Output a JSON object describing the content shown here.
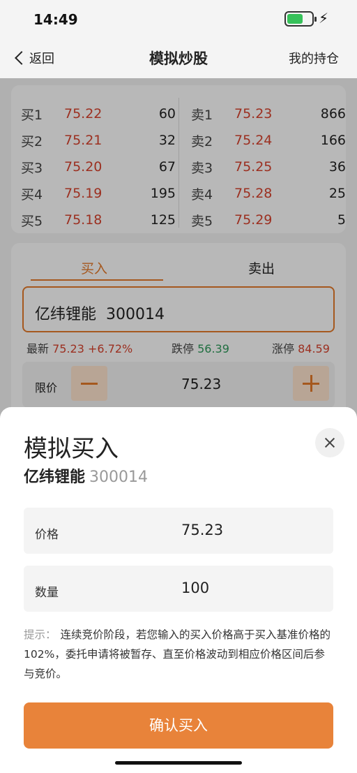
{
  "status_bar": {
    "time": "14:49"
  },
  "nav": {
    "back": "返回",
    "title": "模拟炒股",
    "right": "我的持仓"
  },
  "order_book": {
    "bids": [
      {
        "label": "买1",
        "price": "75.22",
        "volume": "60"
      },
      {
        "label": "买2",
        "price": "75.21",
        "volume": "32"
      },
      {
        "label": "买3",
        "price": "75.20",
        "volume": "67"
      },
      {
        "label": "买4",
        "price": "75.19",
        "volume": "195"
      },
      {
        "label": "买5",
        "price": "75.18",
        "volume": "125"
      }
    ],
    "asks": [
      {
        "label": "卖1",
        "price": "75.23",
        "volume": "866"
      },
      {
        "label": "卖2",
        "price": "75.24",
        "volume": "166"
      },
      {
        "label": "卖3",
        "price": "75.25",
        "volume": "36"
      },
      {
        "label": "卖4",
        "price": "75.28",
        "volume": "25"
      },
      {
        "label": "卖5",
        "price": "75.29",
        "volume": "5"
      }
    ]
  },
  "trade": {
    "tab_buy": "买入",
    "tab_sell": "卖出",
    "stock_name": "亿纬锂能",
    "stock_code": "300014",
    "latest_label": "最新",
    "latest_price": "75.23",
    "change": "+6.72%",
    "limit_down_label": "跌停",
    "limit_down": "56.39",
    "limit_up_label": "涨停",
    "limit_up": "84.59",
    "limit_label": "限价",
    "limit_value": "75.23"
  },
  "sheet": {
    "title": "模拟买入",
    "stock_name": "亿纬锂能",
    "stock_code": "300014",
    "price_label": "价格",
    "price_value": "75.23",
    "qty_label": "数量",
    "qty_value": "100",
    "hint_label": "提示：",
    "hint_text": "连续竞价阶段，若您输入的买入价格高于买入基准价格的102%，委托申请将被暂存、直至价格波动到相应价格区间后参与竞价。",
    "confirm": "确认买入"
  },
  "colors": {
    "accent": "#e8833a",
    "up": "#d8432e",
    "down": "#2e9a5b"
  }
}
